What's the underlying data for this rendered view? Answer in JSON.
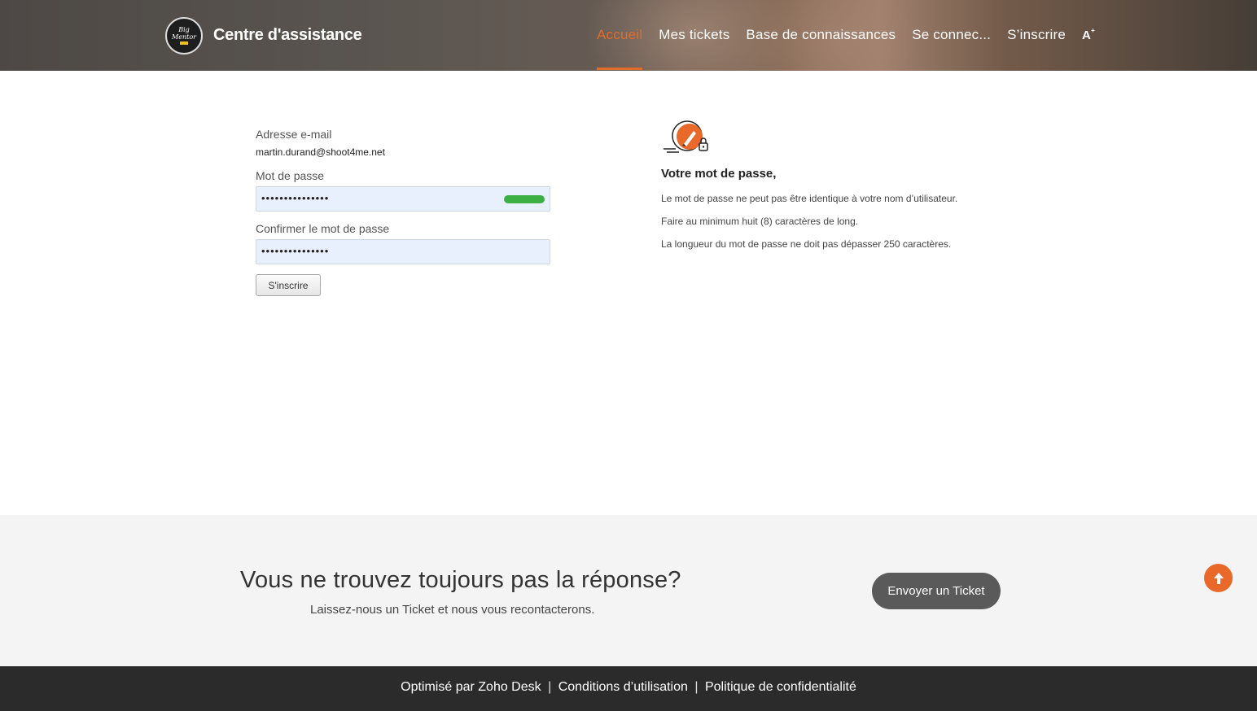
{
  "header": {
    "logo_text_top": "Big",
    "logo_text_bottom": "Mentor",
    "title": "Centre d'assistance",
    "nav": [
      {
        "label": "Accueil",
        "active": true
      },
      {
        "label": "Mes tickets"
      },
      {
        "label": "Base de connaissances"
      },
      {
        "label": "Se connec..."
      },
      {
        "label": "S’inscrire"
      }
    ],
    "accessibility_label": "A"
  },
  "form": {
    "email_label": "Adresse e-mail",
    "email_value": "martin.durand@shoot4me.net",
    "password_label": "Mot de passe",
    "password_value": "•••••••••••••••",
    "password_strength": "strong",
    "confirm_label": "Confirmer le mot de passe",
    "confirm_value": "•••••••••••••••",
    "submit_label": "S'inscrire"
  },
  "password_rules": {
    "icon": "password-edit-icon",
    "title": "Votre mot de passe,",
    "rules": [
      "Le mot de passe ne peut pas être identique à votre nom d’utilisateur.",
      "Faire au minimum huit (8) caractères de long.",
      "La longueur du mot de passe ne doit pas dépasser 250 caractères."
    ]
  },
  "cta": {
    "title": "Vous ne trouvez toujours pas la réponse?",
    "subtitle": "Laissez-nous un Ticket et nous vous recontacterons.",
    "button_label": "Envoyer un Ticket"
  },
  "footer": {
    "links": [
      "Optimisé par Zoho Desk",
      "Conditions d’utilisation",
      "Politique de confidentialité"
    ],
    "separator": "|"
  },
  "colors": {
    "accent": "#e36b2c",
    "strength_bar": "#3cb043",
    "input_bg": "#e8f0fe",
    "footer_bg": "#2b2b2b"
  }
}
